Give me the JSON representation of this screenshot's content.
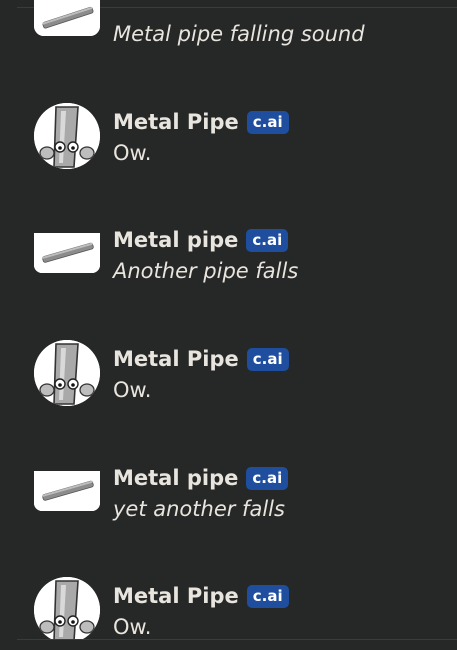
{
  "messages": [
    {
      "type": "partial",
      "name": "",
      "badge": "",
      "text": "Metal pipe falling sound",
      "italic": true,
      "avatar_icon": "metal-pipe-rod-icon"
    },
    {
      "type": "full",
      "name": "Metal Pipe",
      "badge": "c.ai",
      "text": "Ow.",
      "italic": false,
      "avatar_icon": "metal-pipe-face-icon"
    },
    {
      "type": "full",
      "name": "Metal pipe",
      "badge": "c.ai",
      "text": "Another pipe falls",
      "italic": true,
      "avatar_icon": "metal-pipe-rod-icon"
    },
    {
      "type": "full",
      "name": "Metal Pipe",
      "badge": "c.ai",
      "text": "Ow.",
      "italic": false,
      "avatar_icon": "metal-pipe-face-icon"
    },
    {
      "type": "full",
      "name": "Metal pipe",
      "badge": "c.ai",
      "text": "yet another falls",
      "italic": true,
      "avatar_icon": "metal-pipe-rod-icon"
    },
    {
      "type": "full",
      "name": "Metal Pipe",
      "badge": "c.ai",
      "text": "Ow.",
      "italic": false,
      "avatar_icon": "metal-pipe-face-icon"
    }
  ],
  "colors": {
    "background": "#262727",
    "text": "#e8e4de",
    "badge": "#1f4e9e"
  }
}
